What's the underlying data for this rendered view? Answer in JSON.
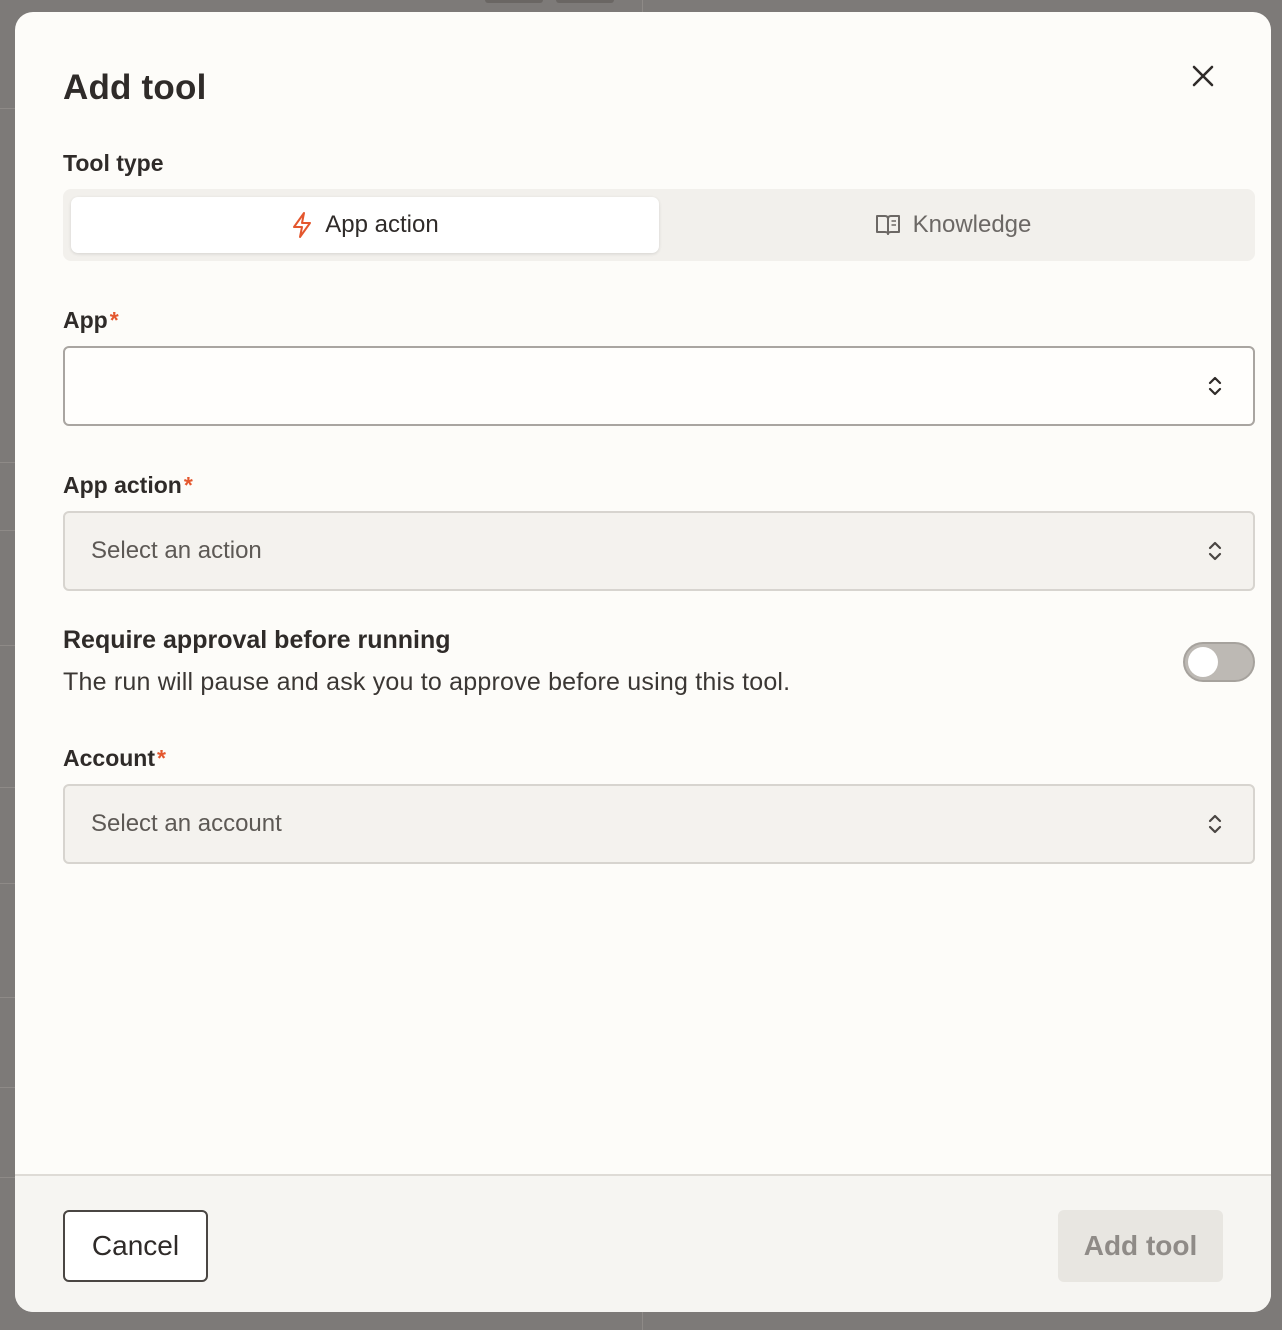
{
  "dialog": {
    "title": "Add tool",
    "close_icon": "close-icon"
  },
  "tool_type": {
    "label": "Tool type",
    "options": [
      {
        "label": "App action",
        "icon": "lightning-icon",
        "selected": true,
        "icon_color": "#e4572e"
      },
      {
        "label": "Knowledge",
        "icon": "book-icon",
        "selected": false
      }
    ]
  },
  "fields": {
    "app": {
      "label": "App",
      "required_marker": "*",
      "value": ""
    },
    "app_action": {
      "label": "App action",
      "required_marker": "*",
      "placeholder": "Select an action"
    },
    "account": {
      "label": "Account",
      "required_marker": "*",
      "placeholder": "Select an account"
    }
  },
  "approval": {
    "title": "Require approval before running",
    "description": "The run will pause and ask you to approve before using this tool.",
    "enabled": false
  },
  "footer": {
    "cancel_label": "Cancel",
    "submit_label": "Add tool"
  },
  "colors": {
    "accent": "#e4572e",
    "backdrop": "#7d7a78",
    "modal_bg": "#fdfcf9"
  }
}
